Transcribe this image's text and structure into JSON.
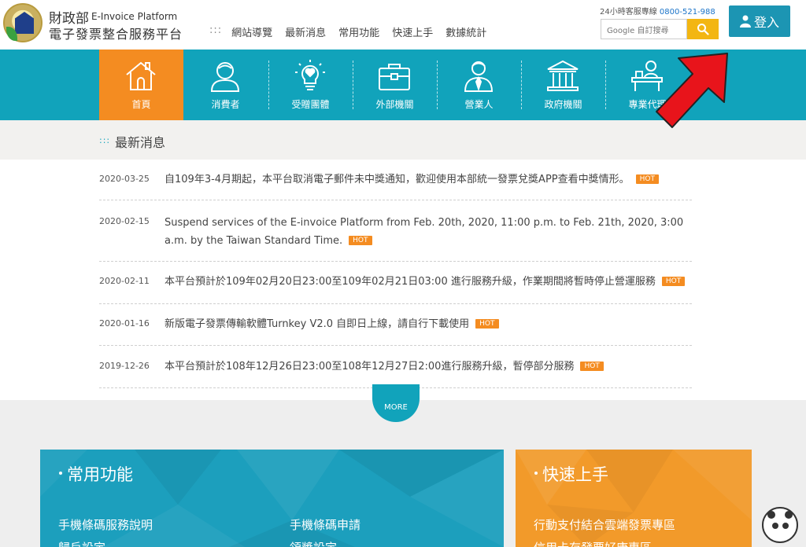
{
  "header": {
    "ministry": "財政部",
    "platform_en": "E-Invoice Platform",
    "platform_zh": "電子發票整合服務平台",
    "topnav_dots": ":::",
    "topnav": [
      "網站導覽",
      "最新消息",
      "常用功能",
      "快速上手",
      "數據統計"
    ],
    "hotline_label": "24小時客服專線",
    "hotline_number": "0800-521-988",
    "search_placeholder": "Google 自訂搜尋",
    "login_label": "登入",
    "accent_color": "#1c95b3",
    "search_button_color": "#f3b612"
  },
  "mainnav": {
    "items": [
      {
        "label": "首頁",
        "icon": "house-icon",
        "active": true
      },
      {
        "label": "消費者",
        "icon": "person-icon",
        "active": false
      },
      {
        "label": "受贈團體",
        "icon": "lightbulb-heart-icon",
        "active": false
      },
      {
        "label": "外部機關",
        "icon": "briefcase-icon",
        "active": false
      },
      {
        "label": "營業人",
        "icon": "businessman-icon",
        "active": false
      },
      {
        "label": "政府機關",
        "icon": "government-building-icon",
        "active": false
      },
      {
        "label": "專業代理",
        "icon": "desk-agent-icon",
        "active": false
      }
    ],
    "bar_color": "#11a3bb",
    "active_color": "#f48c21"
  },
  "news": {
    "title_dots": ":::",
    "title": "最新消息",
    "hot_label": "HOT",
    "items": [
      {
        "date": "2020-03-25",
        "text": "自109年3-4月期起，本平台取消電子郵件未中獎通知，歡迎使用本部統一發票兌獎APP查看中獎情形。"
      },
      {
        "date": "2020-02-15",
        "text": "Suspend services of the E-invoice Platform from Feb. 20th, 2020, 11:00 p.m. to Feb. 21th, 2020, 3:00 a.m. by the Taiwan Standard Time."
      },
      {
        "date": "2020-02-11",
        "text": "本平台預計於109年02月20日23:00至109年02月21日03:00 進行服務升級，作業期間將暫時停止營運服務"
      },
      {
        "date": "2020-01-16",
        "text": "新版電子發票傳輸軟體Turnkey V2.0 自即日上線，請自行下載使用"
      },
      {
        "date": "2019-12-26",
        "text": "本平台預計於108年12月26日23:00至108年12月27日2:00進行服務升級，暫停部分服務"
      }
    ],
    "more_label": "MORE"
  },
  "panels": {
    "common": {
      "title": "常用功能",
      "links": [
        "手機條碼服務說明",
        "手機條碼申請",
        "歸戶設定",
        "領獎設定"
      ]
    },
    "quick": {
      "title": "快速上手",
      "links": [
        "行動支付結合雲端發票專區",
        "信用卡存發票好康專區"
      ]
    }
  },
  "annotation": {
    "arrow_color": "#e8141b"
  }
}
